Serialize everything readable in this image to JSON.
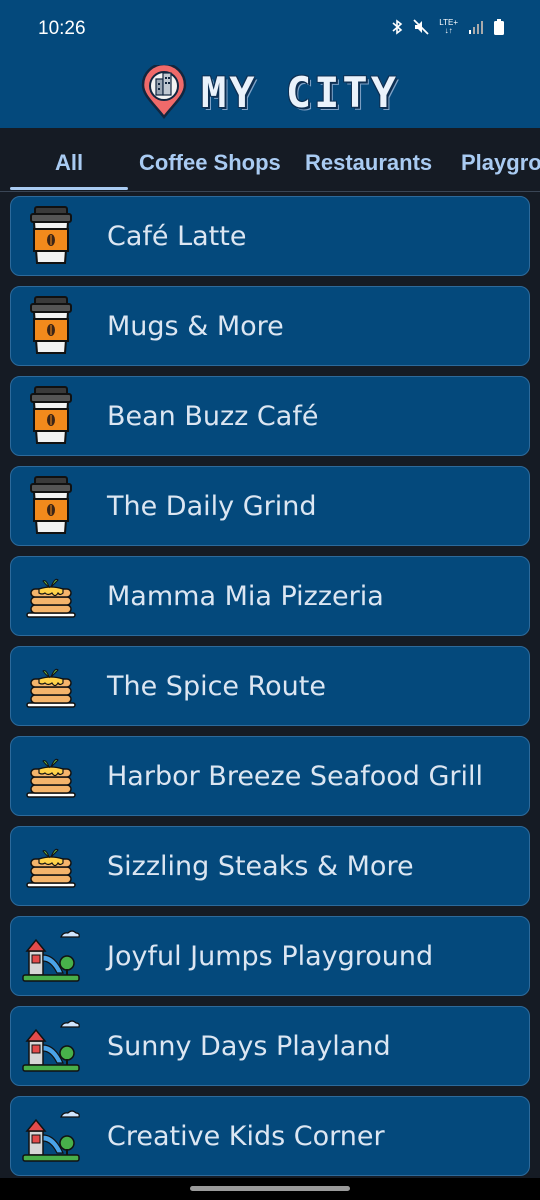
{
  "status": {
    "time": "10:26",
    "network": "LTE+"
  },
  "app": {
    "title": "MY CITY"
  },
  "tabs": [
    {
      "label": "All",
      "active": true
    },
    {
      "label": "Coffee Shops",
      "active": false
    },
    {
      "label": "Restaurants",
      "active": false
    },
    {
      "label": "Playgro",
      "active": false
    }
  ],
  "items": [
    {
      "label": "Café Latte",
      "icon": "coffee-cup-icon"
    },
    {
      "label": "Mugs & More",
      "icon": "coffee-cup-icon"
    },
    {
      "label": "Bean Buzz Café",
      "icon": "coffee-cup-icon"
    },
    {
      "label": "The Daily Grind",
      "icon": "coffee-cup-icon"
    },
    {
      "label": "Mamma Mia Pizzeria",
      "icon": "pancake-stack-icon"
    },
    {
      "label": "The Spice Route",
      "icon": "pancake-stack-icon"
    },
    {
      "label": "Harbor Breeze Seafood Grill",
      "icon": "pancake-stack-icon"
    },
    {
      "label": "Sizzling Steaks & More",
      "icon": "pancake-stack-icon"
    },
    {
      "label": "Joyful Jumps Playground",
      "icon": "playground-icon"
    },
    {
      "label": "Sunny Days Playland",
      "icon": "playground-icon"
    },
    {
      "label": "Creative Kids Corner",
      "icon": "playground-icon"
    }
  ],
  "colors": {
    "appbar": "#04497c",
    "background": "#151b24",
    "tab_text": "#a9cbf2",
    "card": "#04497c"
  }
}
